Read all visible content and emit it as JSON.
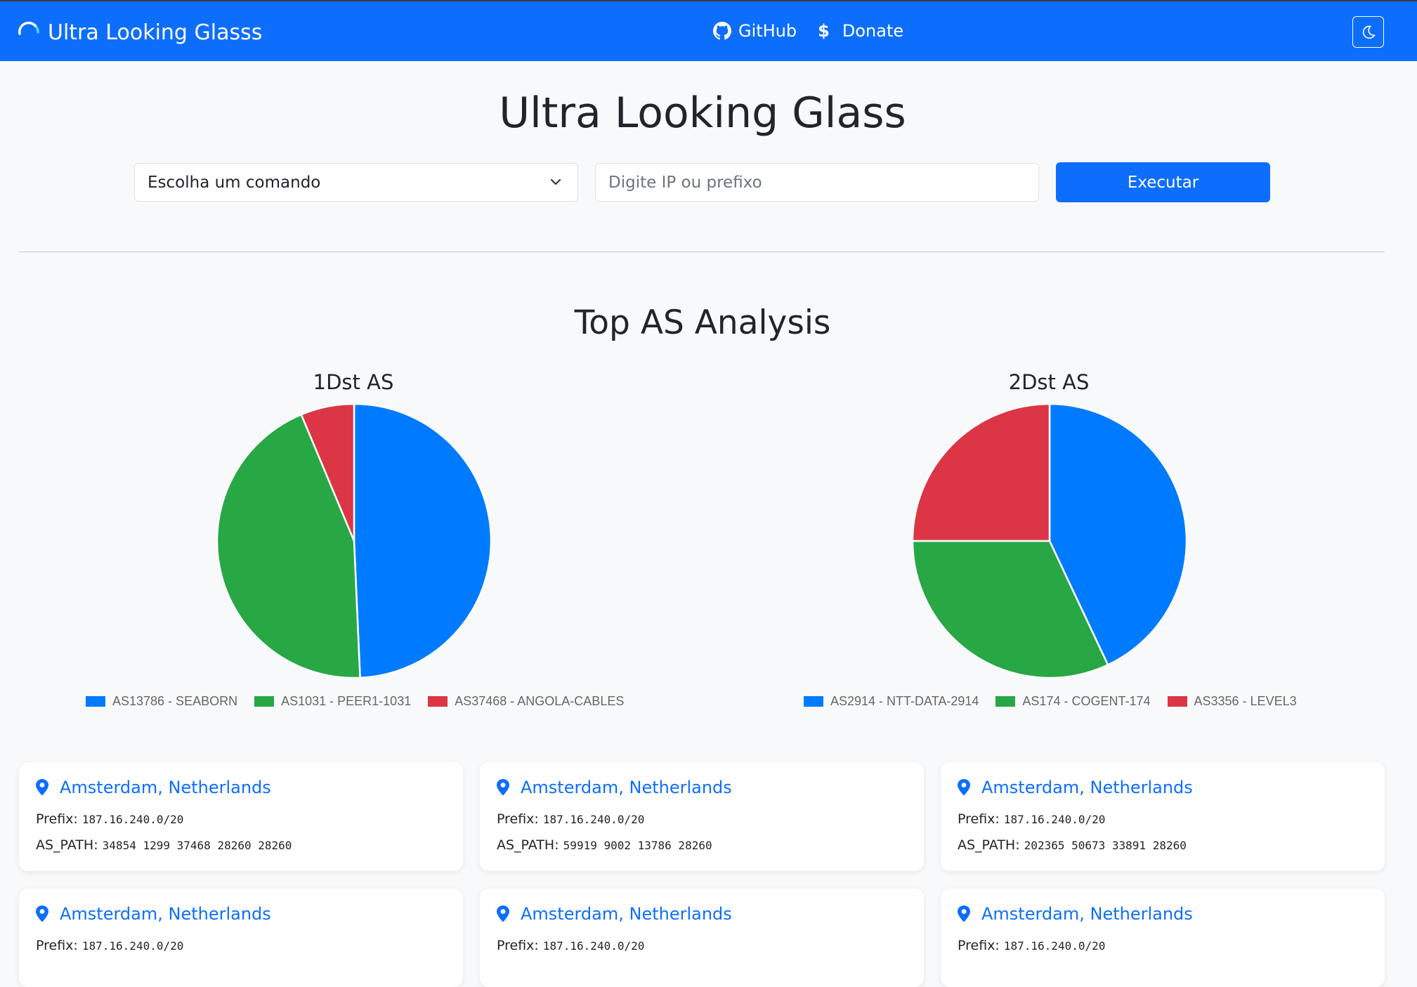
{
  "navbar": {
    "brand": "Ultra Looking Glasss",
    "links": [
      {
        "label": "GitHub",
        "icon": "github-icon"
      },
      {
        "label": "Donate",
        "icon": "dollar-icon"
      }
    ],
    "theme_toggle_icon": "moon-icon",
    "background_color": "#0d6efd"
  },
  "main": {
    "title": "Ultra Looking Glass",
    "command_select": {
      "selected": "Escolha um comando"
    },
    "ip_input": {
      "placeholder": "Digite IP ou prefixo",
      "value": ""
    },
    "execute_label": "Executar"
  },
  "analysis": {
    "title": "Top AS Analysis"
  },
  "chart_data": [
    {
      "type": "pie",
      "title": "1Dst AS",
      "categories": [
        "AS13786 - SEABORN",
        "AS1031 - PEER1-1031",
        "AS37468 - ANGOLA-CABLES"
      ],
      "values": [
        49.3,
        44.4,
        6.3
      ],
      "colors": [
        "#007bff",
        "#28a745",
        "#dc3545"
      ],
      "legend": "bottom"
    },
    {
      "type": "pie",
      "title": "2Dst AS",
      "categories": [
        "AS2914 - NTT-DATA-2914",
        "AS174 - COGENT-174",
        "AS3356 - LEVEL3"
      ],
      "values": [
        43,
        32,
        25
      ],
      "colors": [
        "#007bff",
        "#28a745",
        "#dc3545"
      ],
      "legend": "bottom"
    }
  ],
  "cards": [
    {
      "location": "Amsterdam, Netherlands",
      "prefix_label": "Prefix:",
      "prefix": "187.16.240.0/20",
      "path_label": "AS_PATH:",
      "as_path": "34854 1299 37468 28260 28260"
    },
    {
      "location": "Amsterdam, Netherlands",
      "prefix_label": "Prefix:",
      "prefix": "187.16.240.0/20",
      "path_label": "AS_PATH:",
      "as_path": "59919 9002 13786 28260"
    },
    {
      "location": "Amsterdam, Netherlands",
      "prefix_label": "Prefix:",
      "prefix": "187.16.240.0/20",
      "path_label": "AS_PATH:",
      "as_path": "202365 50673 33891 28260"
    },
    {
      "location": "Amsterdam, Netherlands",
      "prefix_label": "Prefix:",
      "prefix": "187.16.240.0/20"
    },
    {
      "location": "Amsterdam, Netherlands",
      "prefix_label": "Prefix:",
      "prefix": "187.16.240.0/20"
    },
    {
      "location": "Amsterdam, Netherlands",
      "prefix_label": "Prefix:",
      "prefix": "187.16.240.0/20"
    }
  ]
}
